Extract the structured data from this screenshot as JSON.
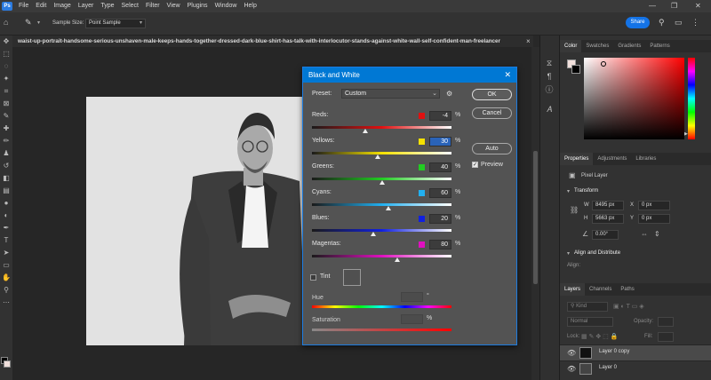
{
  "menubar": {
    "items": [
      "File",
      "Edit",
      "Image",
      "Layer",
      "Type",
      "Select",
      "Filter",
      "View",
      "Plugins",
      "Window",
      "Help"
    ],
    "logo": "Ps"
  },
  "options": {
    "sample_size_label": "Sample Size:",
    "sample_size_value": "Point Sample",
    "share_label": "Share"
  },
  "document": {
    "tab_title": "waist-up-portrait-handsome-serious-unshaven-male-keeps-hands-together-dressed-dark-blue-shirt-has-talk-with-interlocutor-stands-against-white-wall-self-confident-man-freelancer",
    "tab_close": "×"
  },
  "dialog": {
    "title": "Black and White",
    "preset_label": "Preset:",
    "preset_value": "Custom",
    "ok_label": "OK",
    "cancel_label": "Cancel",
    "auto_label": "Auto",
    "preview_label": "Preview",
    "preview_checked": true,
    "sliders": [
      {
        "label": "Reds:",
        "value": "-4",
        "unit": "%",
        "color": "#e01010",
        "fraction": 0.38
      },
      {
        "label": "Yellows:",
        "value": "30",
        "unit": "%",
        "color": "#f5e100",
        "fraction": 0.47
      },
      {
        "label": "Greens:",
        "value": "40",
        "unit": "%",
        "color": "#22cc22",
        "fraction": 0.5
      },
      {
        "label": "Cyans:",
        "value": "60",
        "unit": "%",
        "color": "#22b0f0",
        "fraction": 0.55
      },
      {
        "label": "Blues:",
        "value": "20",
        "unit": "%",
        "color": "#1020e0",
        "fraction": 0.44
      },
      {
        "label": "Magentas:",
        "value": "80",
        "unit": "%",
        "color": "#e010c0",
        "fraction": 0.61
      }
    ],
    "tint_label": "Tint",
    "hue_label": "Hue",
    "hue_unit": "°",
    "saturation_label": "Saturation",
    "saturation_unit": "%"
  },
  "color_panel": {
    "tabs": [
      "Color",
      "Swatches",
      "Gradients",
      "Patterns"
    ],
    "active": "Color"
  },
  "properties": {
    "tabs": [
      "Properties",
      "Adjustments",
      "Libraries"
    ],
    "kind": "Pixel Layer",
    "transform_label": "Transform",
    "w_label": "W",
    "w_value": "8495 px",
    "h_label": "H",
    "h_value": "5663 px",
    "x_label": "X",
    "x_value": "0 px",
    "y_label": "Y",
    "y_value": "0 px",
    "angle_value": "0.00°",
    "align_label": "Align and Distribute",
    "align_sub": "Align:"
  },
  "layers": {
    "tabs": [
      "Layers",
      "Channels",
      "Paths"
    ],
    "kind_placeholder": "Kind",
    "blend_mode": "Normal",
    "opacity_label": "Opacity:",
    "lock_label": "Lock:",
    "fill_label": "Fill:",
    "items": [
      {
        "name": "Layer 0 copy"
      },
      {
        "name": "Layer 0"
      }
    ]
  }
}
